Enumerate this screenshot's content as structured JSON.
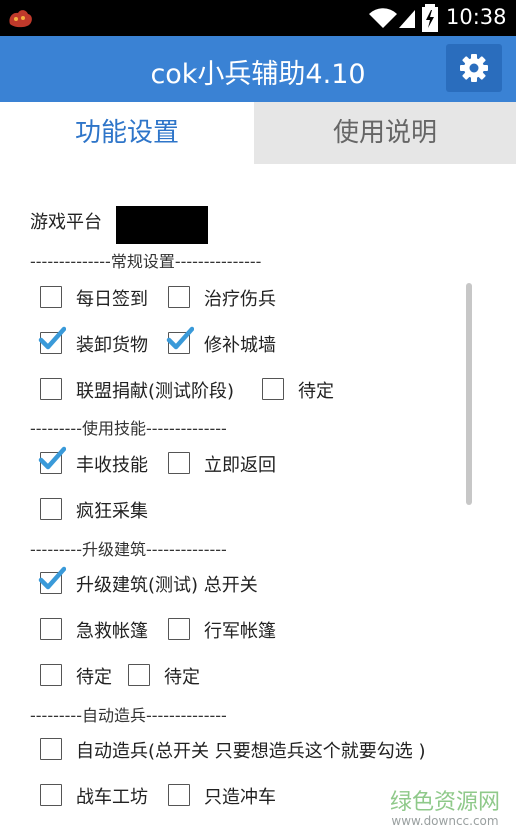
{
  "status_bar": {
    "time": "10:38"
  },
  "app": {
    "title": "cok小兵辅助4.10"
  },
  "tabs": [
    {
      "label": "功能设置",
      "active": true
    },
    {
      "label": "使用说明",
      "active": false
    }
  ],
  "platform": {
    "label": "游戏平台",
    "value": ""
  },
  "sections": {
    "general": "--------------常规设置---------------",
    "skills": "---------使用技能--------------",
    "buildings": "---------升级建筑--------------",
    "troops": "---------自动造兵--------------"
  },
  "options": {
    "daily_checkin": {
      "label": "每日签到",
      "checked": false
    },
    "heal_wounded": {
      "label": "治疗伤兵",
      "checked": false
    },
    "load_goods": {
      "label": "装卸货物",
      "checked": true
    },
    "repair_wall": {
      "label": "修补城墙",
      "checked": true
    },
    "alliance_donate": {
      "label": "联盟捐献(测试阶段)",
      "checked": false
    },
    "pending_1": {
      "label": "待定",
      "checked": false
    },
    "harvest_skill": {
      "label": "丰收技能",
      "checked": true
    },
    "return_now": {
      "label": "立即返回",
      "checked": false
    },
    "crazy_gather": {
      "label": "疯狂采集",
      "checked": false
    },
    "upgrade_master": {
      "label": "升级建筑(测试) 总开关",
      "checked": true
    },
    "first_aid_tent": {
      "label": "急救帐篷",
      "checked": false
    },
    "march_tent": {
      "label": "行军帐篷",
      "checked": false
    },
    "pending_2": {
      "label": "待定",
      "checked": false
    },
    "pending_3": {
      "label": "待定",
      "checked": false
    },
    "auto_train": {
      "label": "自动造兵(总开关 只要想造兵这个就要勾选 )",
      "checked": false
    },
    "chariot_workshop": {
      "label": "战车工坊",
      "checked": false
    },
    "ram_only": {
      "label": "只造冲车",
      "checked": false
    }
  },
  "watermark": {
    "title": "绿色资源网",
    "url": "www.downcc.com"
  },
  "colors": {
    "primary": "#3a82d4",
    "tab_active_text": "#2e75c9",
    "checkmark": "#3a9ad9"
  }
}
